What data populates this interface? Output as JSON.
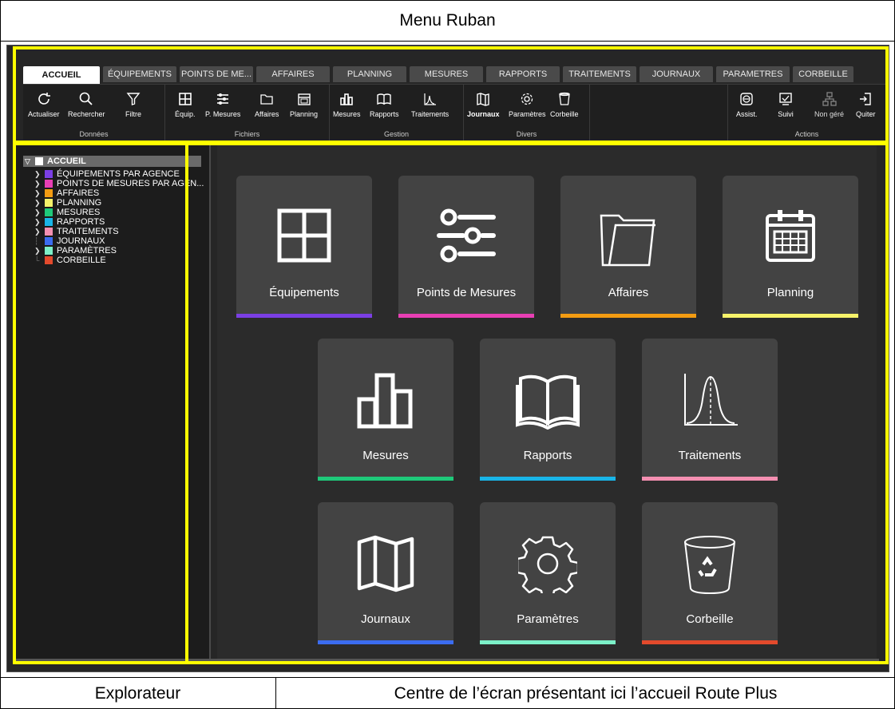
{
  "captions": {
    "top": "Menu Ruban",
    "bottom_left": "Explorateur",
    "bottom_right": "Centre de l’écran présentant ici l’accueil Route Plus"
  },
  "ribbon": {
    "tabs": [
      "ACCUEIL",
      "ÉQUIPEMENTS",
      "POINTS DE ME...",
      "AFFAIRES",
      "PLANNING",
      "MESURES",
      "RAPPORTS",
      "TRAITEMENTS",
      "JOURNAUX",
      "PARAMETRES",
      "CORBEILLE"
    ],
    "groups": {
      "donnees": {
        "label": "Données",
        "buttons": [
          "Actualiser",
          "Rechercher",
          "Filtre"
        ]
      },
      "fichiers": {
        "label": "Fichiers",
        "buttons": [
          "Équip.",
          "P. Mesures",
          "Affaires",
          "Planning"
        ]
      },
      "gestion": {
        "label": "Gestion",
        "buttons": [
          "Mesures",
          "Rapports",
          "Traitements"
        ]
      },
      "divers": {
        "label": "Divers",
        "buttons": [
          "Journaux",
          "Paramètres",
          "Corbeille"
        ]
      },
      "actions": {
        "label": "Actions",
        "buttons": [
          "Assist.",
          "Suivi",
          "Non géré",
          "Quiter"
        ]
      }
    }
  },
  "explorer": {
    "root": "ACCUEIL",
    "items": [
      {
        "label": "ÉQUIPEMENTS PAR AGENCE",
        "color": "#7b3fe4",
        "expandable": true
      },
      {
        "label": "POINTS DE MESURES PAR AGEN...",
        "color": "#e83fb4",
        "expandable": true
      },
      {
        "label": "AFFAIRES",
        "color": "#f39c12",
        "expandable": true
      },
      {
        "label": "PLANNING",
        "color": "#f7f36a",
        "expandable": true
      },
      {
        "label": "MESURES",
        "color": "#1fc97a",
        "expandable": true
      },
      {
        "label": "RAPPORTS",
        "color": "#19b5e8",
        "expandable": true
      },
      {
        "label": "TRAITEMENTS",
        "color": "#f48fb1",
        "expandable": true
      },
      {
        "label": "JOURNAUX",
        "color": "#3b6cf0",
        "expandable": false
      },
      {
        "label": "PARAMÈTRES",
        "color": "#7cf0c8",
        "expandable": true
      },
      {
        "label": "CORBEILLE",
        "color": "#e34a2c",
        "expandable": false
      }
    ]
  },
  "tiles": [
    {
      "label": "Équipements",
      "icon": "grid-icon",
      "color": "#7b3fe4"
    },
    {
      "label": "Points de Mesures",
      "icon": "sliders-icon",
      "color": "#e83fb4"
    },
    {
      "label": "Affaires",
      "icon": "folder-icon",
      "color": "#f39c12"
    },
    {
      "label": "Planning",
      "icon": "calendar-icon",
      "color": "#f7f36a"
    },
    {
      "label": "Mesures",
      "icon": "bar-chart-icon",
      "color": "#1fc97a"
    },
    {
      "label": "Rapports",
      "icon": "book-icon",
      "color": "#19b5e8"
    },
    {
      "label": "Traitements",
      "icon": "curve-icon",
      "color": "#f48fb1"
    },
    {
      "label": "Journaux",
      "icon": "map-icon",
      "color": "#3b6cf0"
    },
    {
      "label": "Paramètres",
      "icon": "gear-icon",
      "color": "#7cf0c8"
    },
    {
      "label": "Corbeille",
      "icon": "recycle-bin-icon",
      "color": "#e34a2c"
    }
  ]
}
